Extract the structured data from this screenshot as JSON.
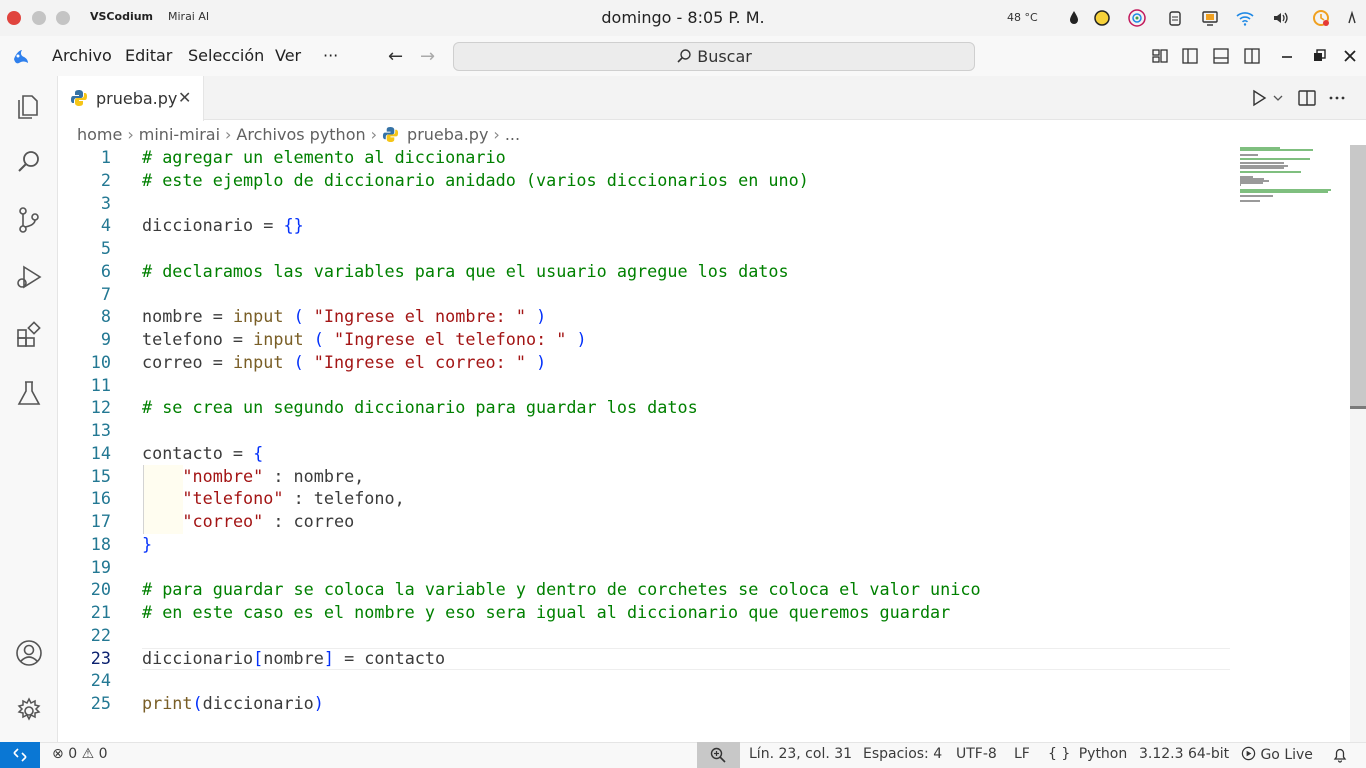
{
  "system": {
    "app_name": "VSCodium",
    "window_name": "Mirai AI",
    "clock": "domingo - 8:05 P. M.",
    "temperature": "48 °C"
  },
  "menu": {
    "items": [
      "Archivo",
      "Editar",
      "Selección",
      "Ver",
      "···"
    ],
    "search_placeholder": "Buscar"
  },
  "tab": {
    "filename": "prueba.py",
    "close": "✕"
  },
  "breadcrumb": {
    "parts": [
      "home",
      "mini-mirai",
      "Archivos python",
      "prueba.py",
      "..."
    ]
  },
  "editor": {
    "active_line": 23,
    "lines": [
      {
        "n": "1",
        "text": "# agregar un elemento al diccionario"
      },
      {
        "n": "2",
        "text": "# este ejemplo de diccionario anidado (varios diccionarios en uno)"
      },
      {
        "n": "3",
        "text": ""
      },
      {
        "n": "4",
        "text": "diccionario = {}"
      },
      {
        "n": "5",
        "text": ""
      },
      {
        "n": "6",
        "text": "# declaramos las variables para que el usuario agregue los datos"
      },
      {
        "n": "7",
        "text": ""
      },
      {
        "n": "8",
        "text": "nombre = input ( \"Ingrese el nombre: \" )"
      },
      {
        "n": "9",
        "text": "telefono = input ( \"Ingrese el telefono: \" )"
      },
      {
        "n": "10",
        "text": "correo = input ( \"Ingrese el correo: \" )"
      },
      {
        "n": "11",
        "text": ""
      },
      {
        "n": "12",
        "text": "# se crea un segundo diccionario para guardar los datos"
      },
      {
        "n": "13",
        "text": ""
      },
      {
        "n": "14",
        "text": "contacto = {"
      },
      {
        "n": "15",
        "text": "    \"nombre\" : nombre,"
      },
      {
        "n": "16",
        "text": "    \"telefono\" : telefono,"
      },
      {
        "n": "17",
        "text": "    \"correo\" : correo"
      },
      {
        "n": "18",
        "text": "}"
      },
      {
        "n": "19",
        "text": ""
      },
      {
        "n": "20",
        "text": "# para guardar se coloca la variable y dentro de corchetes se coloca el valor unico"
      },
      {
        "n": "21",
        "text": "# en este caso es el nombre y eso sera igual al diccionario que queremos guardar"
      },
      {
        "n": "22",
        "text": ""
      },
      {
        "n": "23",
        "text": "diccionario[nombre] = contacto"
      },
      {
        "n": "24",
        "text": ""
      },
      {
        "n": "25",
        "text": "print(diccionario)"
      }
    ]
  },
  "status": {
    "errors": "0",
    "warnings": "0",
    "position": "Lín. 23, col. 31",
    "spaces": "Espacios: 4",
    "encoding": "UTF-8",
    "eol": "LF",
    "language_icon": "{ }",
    "language": "Python",
    "interpreter": "3.12.3 64-bit",
    "golive": "Go Live"
  },
  "colors": {
    "comment": "#008000",
    "string": "#a31515",
    "function": "#795e26",
    "bracket_level1": "#0431fa",
    "bracket_level2": "#319331",
    "bracket_level3": "#7b3814",
    "line_number": "#237893",
    "remote_button": "#0a77d4"
  }
}
